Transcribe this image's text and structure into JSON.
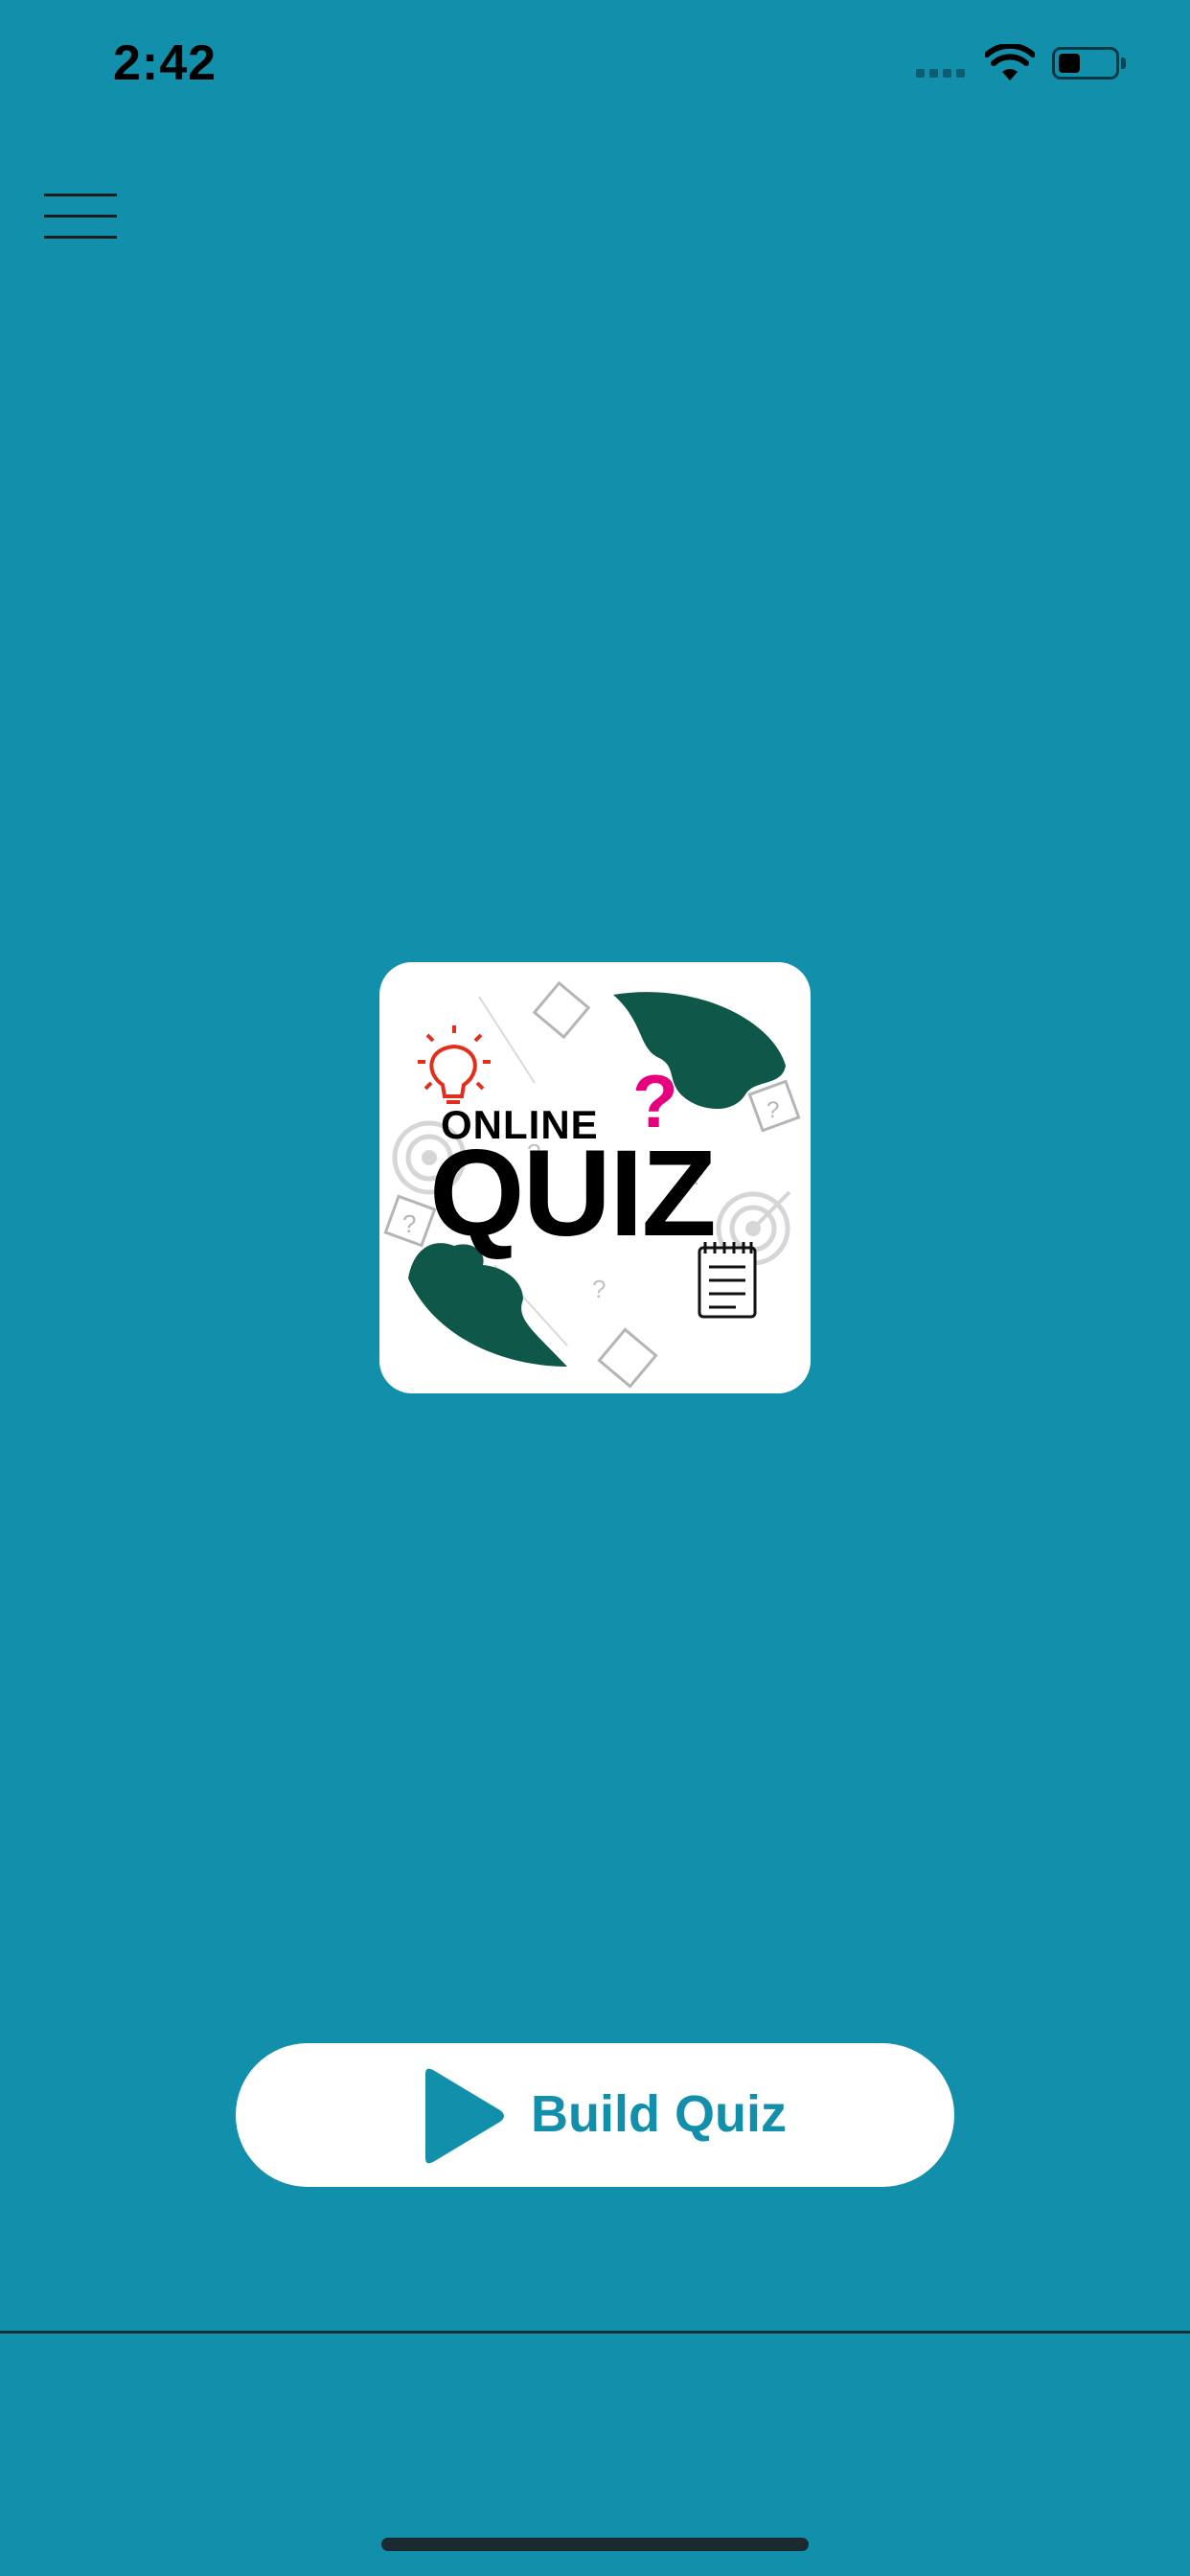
{
  "status_bar": {
    "time": "2:42",
    "battery_level": 0.4
  },
  "colors": {
    "background": "#118fab",
    "accent": "#118fab",
    "logo_green": "#0f5749",
    "logo_magenta": "#e6007e",
    "logo_red": "#e52d1c"
  },
  "logo": {
    "line1": "ONLINE",
    "line2": "QUIZ",
    "mark": "?"
  },
  "build_button": {
    "label": "Build Quiz",
    "icon": "play-icon"
  },
  "icons": {
    "menu": "hamburger-menu-icon",
    "wifi": "wifi-icon",
    "battery": "battery-icon",
    "signal": "cellular-signal-icon"
  }
}
